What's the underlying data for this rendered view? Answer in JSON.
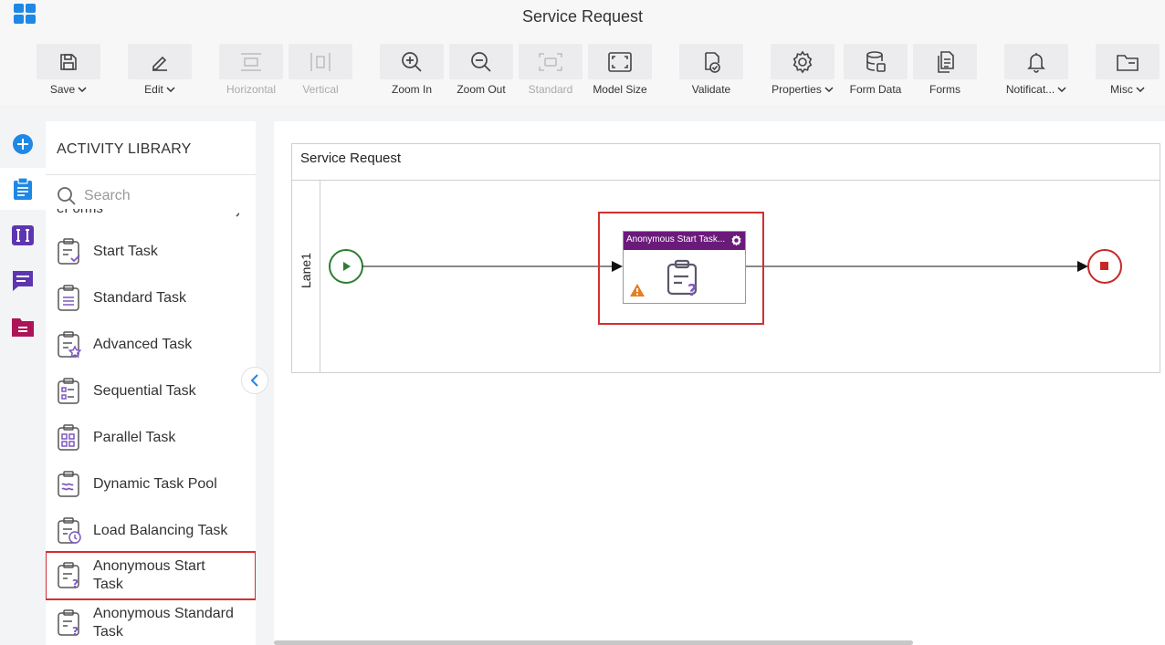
{
  "app": {
    "title": "Service Request"
  },
  "toolbar": {
    "save": "Save",
    "edit": "Edit",
    "horizontal": "Horizontal",
    "vertical": "Vertical",
    "zoom_in": "Zoom In",
    "zoom_out": "Zoom Out",
    "standard": "Standard",
    "model_size": "Model Size",
    "validate": "Validate",
    "properties": "Properties",
    "form_data": "Form Data",
    "forms": "Forms",
    "notifications": "Notificat...",
    "misc": "Misc"
  },
  "library": {
    "title": "ACTIVITY LIBRARY",
    "search_placeholder": "Search",
    "group": "eForms",
    "items": [
      {
        "label": "Start Task",
        "icon": "start-task-icon"
      },
      {
        "label": "Standard Task",
        "icon": "standard-task-icon"
      },
      {
        "label": "Advanced Task",
        "icon": "advanced-task-icon"
      },
      {
        "label": "Sequential Task",
        "icon": "sequential-task-icon"
      },
      {
        "label": "Parallel Task",
        "icon": "parallel-task-icon"
      },
      {
        "label": "Dynamic Task Pool",
        "icon": "dynamic-task-pool-icon"
      },
      {
        "label": "Load Balancing Task",
        "icon": "load-balancing-task-icon"
      },
      {
        "label": "Anonymous Start Task",
        "icon": "anonymous-start-task-icon"
      },
      {
        "label": "Anonymous Standard Task",
        "icon": "anonymous-standard-task-icon"
      }
    ]
  },
  "canvas": {
    "pool_title": "Service Request",
    "lane_label": "Lane1",
    "task_title": "Anonymous Start Task..."
  },
  "colors": {
    "accent_blue": "#1e88e5",
    "purple": "#6a1b7a",
    "highlight_red": "#d32f2f",
    "start_green": "#2e7d32",
    "end_red": "#c62828"
  }
}
